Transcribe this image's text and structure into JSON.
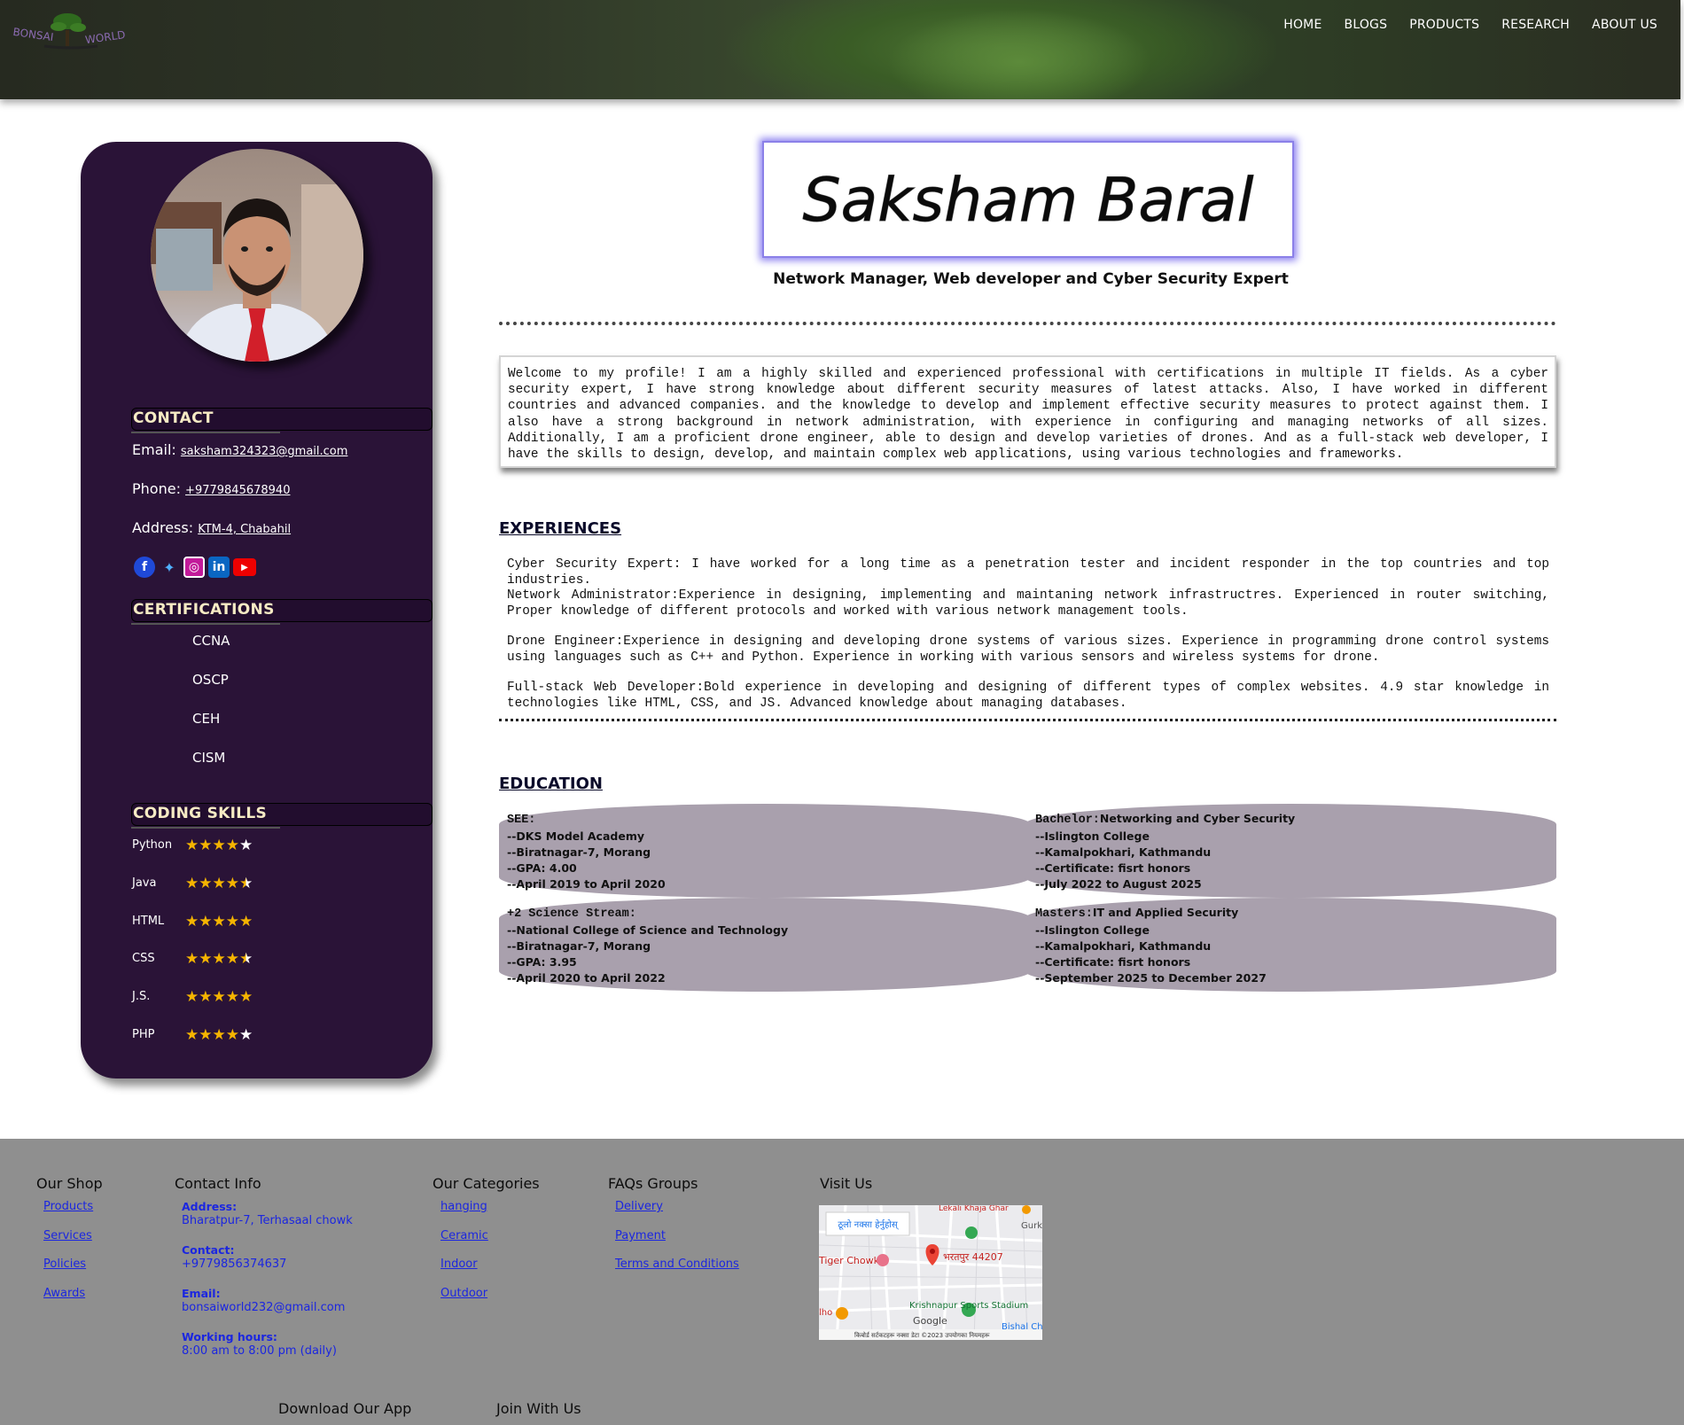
{
  "header": {
    "logo_text": "BONSAI WORLD",
    "nav": [
      "HOME",
      "BLOGS",
      "PRODUCTS",
      "RESEARCH",
      "ABOUT US"
    ]
  },
  "sidebar": {
    "contact": {
      "title": "CONTACT",
      "email_label": "Email:",
      "email": "saksham324323@gmail.com",
      "phone_label": "Phone:",
      "phone": "+9779845678940",
      "address_label": "Address:",
      "address": "KTM-4, Chabahil"
    },
    "socials": [
      "facebook-icon",
      "twitter-icon",
      "instagram-icon",
      "linkedin-icon",
      "youtube-icon"
    ],
    "certifications": {
      "title": "CERTIFICATIONS",
      "items": [
        "CCNA",
        "OSCP",
        "CEH",
        "CISM"
      ]
    },
    "skills": {
      "title": "CODING SKILLS",
      "items": [
        {
          "name": "Python",
          "stars": 4
        },
        {
          "name": "Java",
          "stars": 4.5
        },
        {
          "name": "HTML",
          "stars": 5
        },
        {
          "name": "CSS",
          "stars": 4.5
        },
        {
          "name": "J.S.",
          "stars": 5
        },
        {
          "name": "PHP",
          "stars": 4
        }
      ]
    }
  },
  "main": {
    "name": "Saksham Baral",
    "tagline": "Network Manager, Web developer and Cyber Security Expert",
    "intro": "Welcome to my profile! I am a highly skilled and experienced professional with certifications in multiple IT fields. As a cyber security expert, I have strong knowledge about different security measures of latest attacks. Also, I have worked in different countries and advanced companies. and the knowledge to develop and implement effective security measures to protect against them. I also have a strong background in network administration, with experience in configuring and managing networks of all sizes. Additionally, I am a proficient drone engineer, able to design and develop varieties of drones. And as a full-stack web developer, I have the skills to design, develop, and maintain complex web applications, using various technologies and frameworks.",
    "experiences_title": "EXPERIENCES",
    "experiences": [
      "Cyber Security Expert: I have worked for a long time as a penetration tester and incident responder in the top countries and top industries.",
      "Network Administrator:Experience in designing, implementing and maintaning network infrastructres. Experienced in router switching, Proper knowledge of different protocols and worked with various network management tools.",
      "Drone Engineer:Experience in designing and developing drone systems of various sizes. Experience in programming drone control systems using languages such as C++ and Python. Experience in working with various sensors and wireless systems for drone.",
      "Full-stack Web Developer:Bold experience in developing and designing of different types of complex websites. 4.9 star knowledge in technologies like HTML, CSS, and JS. Advanced knowledge about managing databases."
    ],
    "education_title": "EDUCATION",
    "education": [
      {
        "label": "SEE:",
        "title": "",
        "lines": [
          "--DKS Model Academy",
          "--Biratnagar-7, Morang",
          "--GPA: 4.00",
          "--April 2019 to April 2020"
        ]
      },
      {
        "label": "Bachelor:",
        "title": "Networking and Cyber Security",
        "lines": [
          "--Islington College",
          "--Kamalpokhari, Kathmandu",
          "--Certificate: fisrt honors",
          "--July 2022 to August 2025"
        ]
      },
      {
        "label": "+2 Science Stream:",
        "title": "",
        "lines": [
          "--National College of Science and Technology",
          "--Biratnagar-7, Morang",
          "--GPA: 3.95",
          "--April 2020 to April 2022"
        ]
      },
      {
        "label": "Masters:",
        "title": "IT and Applied Security",
        "lines": [
          "--Islington College",
          "--Kamalpokhari, Kathmandu",
          "--Certificate: fisrt honors",
          "--September 2025 to December 2027"
        ]
      }
    ]
  },
  "footer": {
    "shop": {
      "title": "Our Shop",
      "links": [
        "Products",
        "Services",
        "Policies",
        "Awards"
      ]
    },
    "contact": {
      "title": "Contact Info",
      "address_label": "Address:",
      "address": "Bharatpur-7, Terhasaal chowk",
      "contact_label": "Contact:",
      "contact": "+9779856374637",
      "email_label": "Email:",
      "email": "bonsaiworld232@gmail.com",
      "hours_label": "Working hours:",
      "hours": "8:00 am to 8:00 pm (daily)"
    },
    "categories": {
      "title": "Our Categories",
      "links": [
        "hanging",
        "Ceramic",
        "Indoor",
        "Outdoor"
      ]
    },
    "faqs": {
      "title": "FAQs Groups",
      "links": [
        "Delivery",
        "Payment",
        "Terms and Conditions"
      ]
    },
    "visit": {
      "title": "Visit Us",
      "map_labels": {
        "top_button": "ठूलो नक्सा हेर्नुहोस्",
        "top_place": "Lekali Khaja Ghar",
        "pin": "भरतपुर 44207",
        "left": "Tiger Chowk",
        "right": "Gurk Educa",
        "stadium": "Krishnapur Sports Stadium",
        "google": "Google",
        "bottom_right": "Bishal Ch",
        "left2": "lho",
        "footer": "किबोर्ड सर्टकटहरू   नक्सा डेटा ©2023   उपयोगका नियमहरू"
      }
    },
    "download": "Download Our App",
    "join": "Join With Us"
  }
}
